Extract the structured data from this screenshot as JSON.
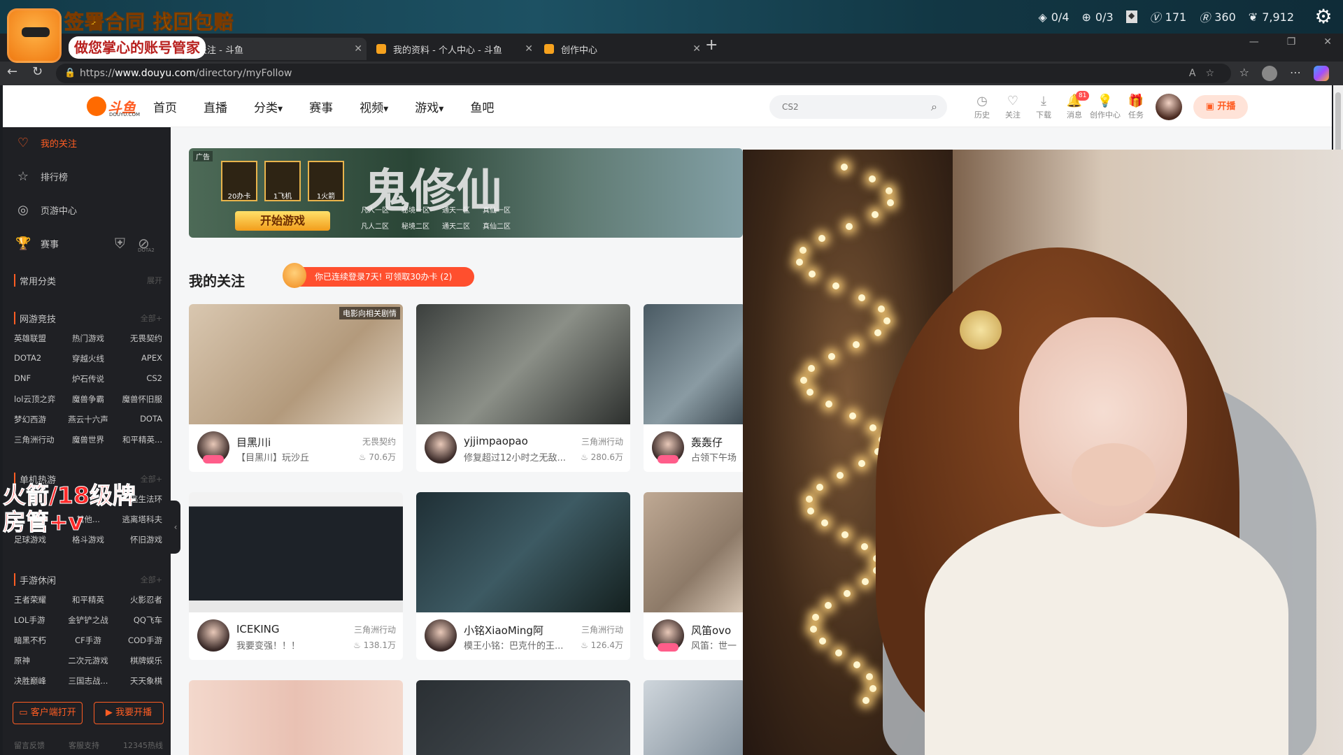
{
  "overlay_top": {
    "stats": [
      {
        "icon": "diamond-icon",
        "text": "0/4"
      },
      {
        "icon": "plus-circle-icon",
        "text": "0/3"
      },
      {
        "icon": "square-icon",
        "text": ""
      },
      {
        "icon": "v-badge-icon",
        "text": "171"
      },
      {
        "icon": "r-badge-icon",
        "text": "360"
      },
      {
        "icon": "leaf-icon",
        "text": "7,912"
      }
    ]
  },
  "promo": {
    "line1": "签署合同 找回包赔",
    "line2": "做您掌心的账号管家"
  },
  "browser": {
    "tabs": [
      {
        "title": "的关注 - 斗鱼",
        "active": true
      },
      {
        "title": "我的资料 - 个人中心 - 斗鱼",
        "active": false
      },
      {
        "title": "创作中心",
        "active": false
      }
    ],
    "url_prefix": "https://",
    "url_host": "www.douyu.com",
    "url_path": "/directory/myFollow"
  },
  "header": {
    "logo_text": "斗鱼",
    "logo_domain": "DOUYU.COM",
    "nav": [
      "首页",
      "直播",
      "分类",
      "赛事",
      "视频",
      "游戏",
      "鱼吧"
    ],
    "search_placeholder": "CS2",
    "icons": [
      {
        "label": "历史",
        "icon": "history-icon"
      },
      {
        "label": "关注",
        "icon": "heart-icon"
      },
      {
        "label": "下载",
        "icon": "download-icon"
      },
      {
        "label": "消息",
        "icon": "bell-icon",
        "badge": "81"
      },
      {
        "label": "创作中心",
        "icon": "bulb-icon"
      },
      {
        "label": "任务",
        "icon": "gift-icon"
      }
    ],
    "open_button": "开播"
  },
  "sidebar": {
    "main_items": [
      {
        "label": "我的关注",
        "icon": "heart-icon",
        "active": true
      },
      {
        "label": "排行榜",
        "icon": "rank-icon",
        "active": false
      },
      {
        "label": "页游中心",
        "icon": "controller-icon",
        "active": false
      },
      {
        "label": "赛事",
        "icon": "trophy-icon",
        "active": false
      }
    ],
    "match_tags": [
      "DOTA2"
    ],
    "common": {
      "title": "常用分类",
      "more": "展开"
    },
    "sections": [
      {
        "title": "网游竞技",
        "more": "全部+",
        "items": [
          "英雄联盟",
          "热门游戏",
          "无畏契约",
          "DOTA2",
          "穿越火线",
          "APEX",
          "DNF",
          "炉石传说",
          "CS2",
          "lol云顶之弈",
          "魔兽争霸",
          "魔兽怀旧服",
          "梦幻西游",
          "燕云十六声",
          "DOTA",
          "三角洲行动",
          "魔兽世界",
          "和平精英..."
        ]
      },
      {
        "title": "单机热游",
        "more": "全部+",
        "items": [
          "",
          "",
          "逃生法环",
          "",
          "其他...",
          "逃离塔科夫",
          "足球游戏",
          "格斗游戏",
          "怀旧游戏"
        ]
      },
      {
        "title": "手游休闲",
        "more": "全部+",
        "items": [
          "王者荣耀",
          "和平精英",
          "火影忍者",
          "LOL手游",
          "金铲铲之战",
          "QQ飞车",
          "暗黑不朽",
          "CF手游",
          "COD手游",
          "原神",
          "二次元游戏",
          "棋牌娱乐",
          "决胜巅峰",
          "三国志战...",
          "天天象棋"
        ]
      }
    ],
    "overlay_text": [
      "火箭/18级牌",
      "房管+v"
    ],
    "buttons": [
      "客户端打开",
      "我要开播"
    ],
    "footer": [
      "留言反馈",
      "客服支持",
      "12345热线"
    ]
  },
  "banner": {
    "tag": "广告",
    "items": [
      "20办卡",
      "1飞机",
      "1火箭"
    ],
    "cta": "开始游戏",
    "title": "鬼修仙",
    "servers": [
      "凡人一区",
      "秘境一区",
      "通天一区",
      "真仙一区",
      "凡人二区",
      "秘境二区",
      "通天二区",
      "真仙二区"
    ]
  },
  "follow": {
    "title": "我的关注",
    "login_tip": "你已连续登录7天! 可领取30办卡 (2)"
  },
  "cards": [
    {
      "name": "目黑川i",
      "game": "无畏契约",
      "desc": "【目黑川】玩沙丘",
      "hot": "70.6万",
      "overlay": "电影向相关剧情"
    },
    {
      "name": "yjjimpaopao",
      "game": "三角洲行动",
      "desc": "修复超过12小时之无敌...",
      "hot": "280.6万",
      "overlay": ""
    },
    {
      "name": "轰轰仔",
      "game": "",
      "desc": "占领下午场",
      "hot": "",
      "overlay": ""
    },
    {
      "name": "ICEKING",
      "game": "三角洲行动",
      "desc": "我要变强！！！",
      "hot": "138.1万",
      "overlay": ""
    },
    {
      "name": "小铭XiaoMing阿",
      "game": "三角洲行动",
      "desc": "模王小铭：巴克什的王...",
      "hot": "126.4万",
      "overlay": ""
    },
    {
      "name": "风笛ovo",
      "game": "",
      "desc": "风笛：世一",
      "hot": "",
      "overlay": ""
    }
  ]
}
